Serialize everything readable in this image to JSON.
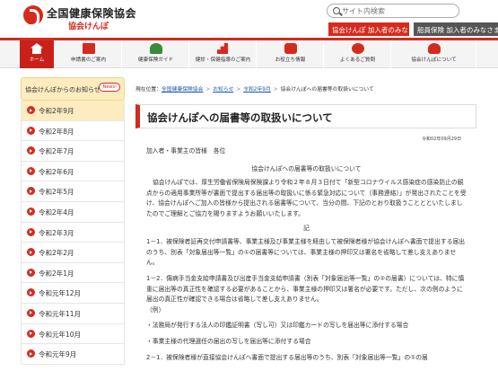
{
  "header": {
    "site_title": "全国健康保険協会",
    "site_sub": "協会けんぽ",
    "search_placeholder": "サイト内検索",
    "tab_user": "協会けんぽ 加入者のみなさま",
    "tab_crew": "船員保険 加入者のみなさま"
  },
  "nav": {
    "items": [
      {
        "label": "ホーム",
        "icon": "home-icon"
      },
      {
        "label": "申請書のご案内",
        "icon": "document-icon"
      },
      {
        "label": "健康保険ガイド",
        "icon": "people-icon"
      },
      {
        "label": "健診・保健指導のご案内",
        "icon": "chart-icon"
      },
      {
        "label": "お役立ち情報",
        "icon": "hand-icon"
      },
      {
        "label": "よくあるご質問",
        "icon": "chat-icon"
      },
      {
        "label": "協会けんぽについて",
        "icon": "family-icon"
      }
    ]
  },
  "sidebar": {
    "heading": "協会けんぽからのお知らせ",
    "badge": "News!",
    "items": [
      "令和2年9月",
      "令和2年8月",
      "令和2年7月",
      "令和2年6月",
      "令和2年5月",
      "令和2年4月",
      "令和2年3月",
      "令和2年2月",
      "令和2年1月",
      "令和元年12月",
      "令和元年11月",
      "令和元年10月",
      "令和元年9月"
    ]
  },
  "breadcrumb": {
    "prefix": "現在位置：",
    "links": [
      "全国健康保険協会",
      "お知らせ",
      "令和2年9月"
    ],
    "current": "協会けんぽへの届書等の取扱いについて",
    "separator": ">"
  },
  "page": {
    "title": "協会けんぽへの届書等の取扱いについて",
    "date": "令和02年09月29日",
    "addressee": "加入者・事業主の皆様　各位",
    "content_title": "協会けんぽへの届書等の取扱いについて",
    "para1": "協会けんぽでは、厚生労働省保険局保険課より令和２年８月３日付て「新型コロナウイルス感染症の感染防止の観点からの適用事業所等が書面で提出する届出等の取扱いに係る緊急対応について（事務連絡）」が発出されたことを受け、協会けんぽへご加入の皆様から提出される届書等について、当分の間、下記のとおり取扱うこととといたしましたのでご理解とご協力を賜りますようお願いいたします。",
    "ki": "記",
    "item1": "1－1．被保険者証再交付申請書等、事業主様及び事業主様を経由して被保険者様が協会けんぽへ書面で提出する届出のうち、別表「対象届出等一覧」の①の届書等については、事業主様の押印又は署名を省略して差し支えありません。",
    "item2": "1－2．傷病手当金支給申請書及び出産手当金支給申請書（別表「対象届出等一覧」の②の届書）については、特に慎重に届出等の真正性を確認する必要があることから、事業主様の押印又は署名が必要です。ただし、次の例のように届出の真正性が確認できる場合は省略して差し支えありません。",
    "ex": "（例）",
    "ex1": "・法務局が発行する法人の印鑑証明書（写し可）又は印鑑カードの写しを届出等に添付する場合",
    "ex2": "・事業主様の代理選任の届出の写しを届出等に添付する場合",
    "item3": "2－1．被保険者様が直接協会けんぽへ書面で提出する届出等のうち、別表「対象届出等一覧」の①の届"
  },
  "colors": {
    "accent": "#d52b1e",
    "sidebar_active": "#fcecc0"
  }
}
